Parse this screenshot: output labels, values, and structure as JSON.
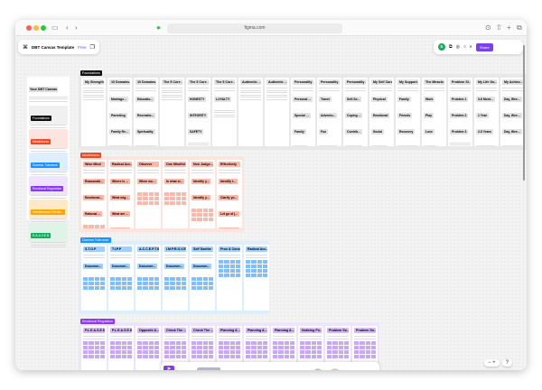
{
  "browser": {
    "url": "figma.com"
  },
  "header": {
    "file_title": "DBT Canvas Template",
    "plan_badge": "Free",
    "share_label": "Share",
    "avatar_initial": "B"
  },
  "colors": {
    "accent": "#7b3ff2",
    "foundations": "#e8e8e8",
    "mindfulness": "#fde4de",
    "distress": "#dfeeff",
    "emotional": "#efe4fd",
    "interpersonal": "#ffe9c7",
    "raaven": "#dff3e6"
  },
  "left_panel": {
    "title": "Your DBT Canvas",
    "cards": [
      {
        "label": "Foundations",
        "color": "#111111",
        "bg": "#f0f0f0"
      },
      {
        "label": "Mindfulness",
        "color": "#f24822",
        "bg": "#fde4de"
      },
      {
        "label": "Distress Tolerance",
        "color": "#1e90ff",
        "bg": "#dfeeff"
      },
      {
        "label": "Emotional Regulation",
        "color": "#8a38f5",
        "bg": "#efe4fd"
      },
      {
        "label": "Interpersonal Effectiv...",
        "color": "#ffa500",
        "bg": "#ffe9c7"
      },
      {
        "label": "R.A.A.V.E.N",
        "color": "#14ae5c",
        "bg": "#dff3e6"
      }
    ]
  },
  "sections": [
    {
      "key": "foundations",
      "label": "Foundations",
      "labelColor": "#111111",
      "chip": "#e2e2e2",
      "cell": "#e2e2e2",
      "columns": [
        {
          "title": "My Strengths",
          "chips": []
        },
        {
          "title": "10 Domains...",
          "chips": [
            "Marriage...",
            "Parenting",
            "Family Re...",
            "Friendshi..."
          ]
        },
        {
          "title": "10 Domains... Career, V...",
          "chips": [
            "Educatio...",
            "Recreatio...",
            "Spirituality",
            "Citizenshi..."
          ]
        },
        {
          "title": "The 5 Core ... General In...",
          "chips": []
        },
        {
          "title": "The 5 Core ...",
          "chips": [
            "HONESTY",
            "INTEGRITY",
            "SAFETY"
          ]
        },
        {
          "title": "The 5 Core ...",
          "chips": [
            "LOYALTY"
          ]
        },
        {
          "title": "Authentic ...",
          "chips": []
        },
        {
          "title": "Authentic ...",
          "chips": []
        },
        {
          "title": "Personality ...",
          "chips": [
            "Personal ...",
            "Special ...",
            "Family",
            "Friends",
            "Pets",
            "Favorite ...",
            "Books",
            "TV Shows",
            "Movies",
            "Music"
          ]
        },
        {
          "title": "Personality ...",
          "chips": [
            "Travel",
            "Adventu...",
            "Fun",
            "How do I...",
            "Style",
            "Doing a R...",
            "Style"
          ]
        },
        {
          "title": "Personality ...",
          "chips": [
            "Self-Se...",
            "Coping ...",
            "Contrib...",
            "Charact...",
            "Passion",
            "Purpose"
          ]
        },
        {
          "title": "My Self Care",
          "chips": [
            "Physical",
            "Emotional",
            "Social",
            "Spiritual"
          ]
        },
        {
          "title": "My Support...",
          "chips": [
            "Family",
            "Friends",
            "Recovery",
            "Community",
            "Other"
          ]
        },
        {
          "title": "The Miracle...",
          "chips": [
            "Work",
            "Play",
            "Love",
            "Health"
          ]
        },
        {
          "title": "Problem Sl...",
          "chips": [
            "Problem 1",
            "Problem 2",
            "Problem 3"
          ]
        },
        {
          "title": "My Life Go...",
          "chips": [
            "3-6 Mont...",
            "1 Year",
            "2-5 Years",
            "5-10 Years"
          ]
        },
        {
          "title": "My Achiev...",
          "chips": [
            "Day, Wee...",
            "Day, Wee...",
            "Day, Wee...",
            "Day, Wee..."
          ]
        }
      ]
    },
    {
      "key": "mindfulness",
      "label": "Mindfulness",
      "labelColor": "#f24822",
      "chip": "#fbb7a8",
      "cell": "#fbb7a8",
      "columns": [
        {
          "title": "Wise Mind",
          "chips": [
            "Reasonabl...",
            "Emotional...",
            "Rational ..."
          ]
        },
        {
          "title": "Radical Acc...",
          "chips": [
            "Where is ...",
            "What mig...",
            "What are ...",
            "What are ..."
          ]
        },
        {
          "title": "Observe",
          "chips": [
            "When wo..."
          ]
        },
        {
          "title": "One Mindful",
          "chips": [
            "In what si..."
          ]
        },
        {
          "title": "Non Judge...",
          "chips": [
            "Identify y...",
            "Identify y..."
          ]
        },
        {
          "title": "Effectively",
          "chips": [
            "Identify t...",
            "Clarify yo...",
            "Let go of j...",
            "Focus on ...",
            "Adapt as ..."
          ]
        }
      ]
    },
    {
      "key": "distress",
      "label": "Distress Tolerance",
      "labelColor": "#1e90ff",
      "chip": "#9fd0ff",
      "cell": "#7fbfff",
      "columns": [
        {
          "title": "S.T.O.P",
          "chips": [
            "Documen..."
          ]
        },
        {
          "title": "T.I.P.P",
          "chips": [
            "Documen..."
          ]
        },
        {
          "title": "A.C.C.E.P.T.S",
          "chips": [
            "Documen..."
          ]
        },
        {
          "title": "I.M.P.R.O.V.E",
          "chips": [
            "Documen..."
          ]
        },
        {
          "title": "Self Soothe",
          "chips": [
            "Documen..."
          ]
        },
        {
          "title": "Pros & Cons",
          "chips": []
        },
        {
          "title": "Radical Acc...",
          "chips": []
        }
      ]
    },
    {
      "key": "emotional",
      "label": "Emotional Regulation",
      "labelColor": "#8a38f5",
      "chip": "#d5b8fb",
      "cell": "#c9a6fa",
      "columns": [
        {
          "title": "P.L.E.A.S.E.D",
          "chips": []
        },
        {
          "title": "P.L.E.A.S.E.D...",
          "chips": []
        },
        {
          "title": "Opposite A...",
          "chips": []
        },
        {
          "title": "Check The ...",
          "chips": []
        },
        {
          "title": "Check The ...",
          "chips": []
        },
        {
          "title": "Planning A...",
          "chips": []
        },
        {
          "title": "Planning A...",
          "chips": []
        },
        {
          "title": "Planning A...",
          "chips": []
        },
        {
          "title": "Noticing Po...",
          "chips": []
        },
        {
          "title": "Problem So...",
          "chips": []
        },
        {
          "title": "Problem So...",
          "chips": []
        }
      ]
    }
  ],
  "toolbar": {
    "tools": [
      {
        "name": "text-tool-icon",
        "glyph": "T"
      },
      {
        "name": "frame-tool-icon",
        "glyph": "⌐"
      },
      {
        "name": "table-tool-icon",
        "glyph": "▤"
      },
      {
        "name": "stamp-tool-icon",
        "glyph": "♙"
      }
    ],
    "add_glyph": "+"
  },
  "zoom": {
    "minus": "−",
    "plus": "+",
    "help": "?"
  }
}
